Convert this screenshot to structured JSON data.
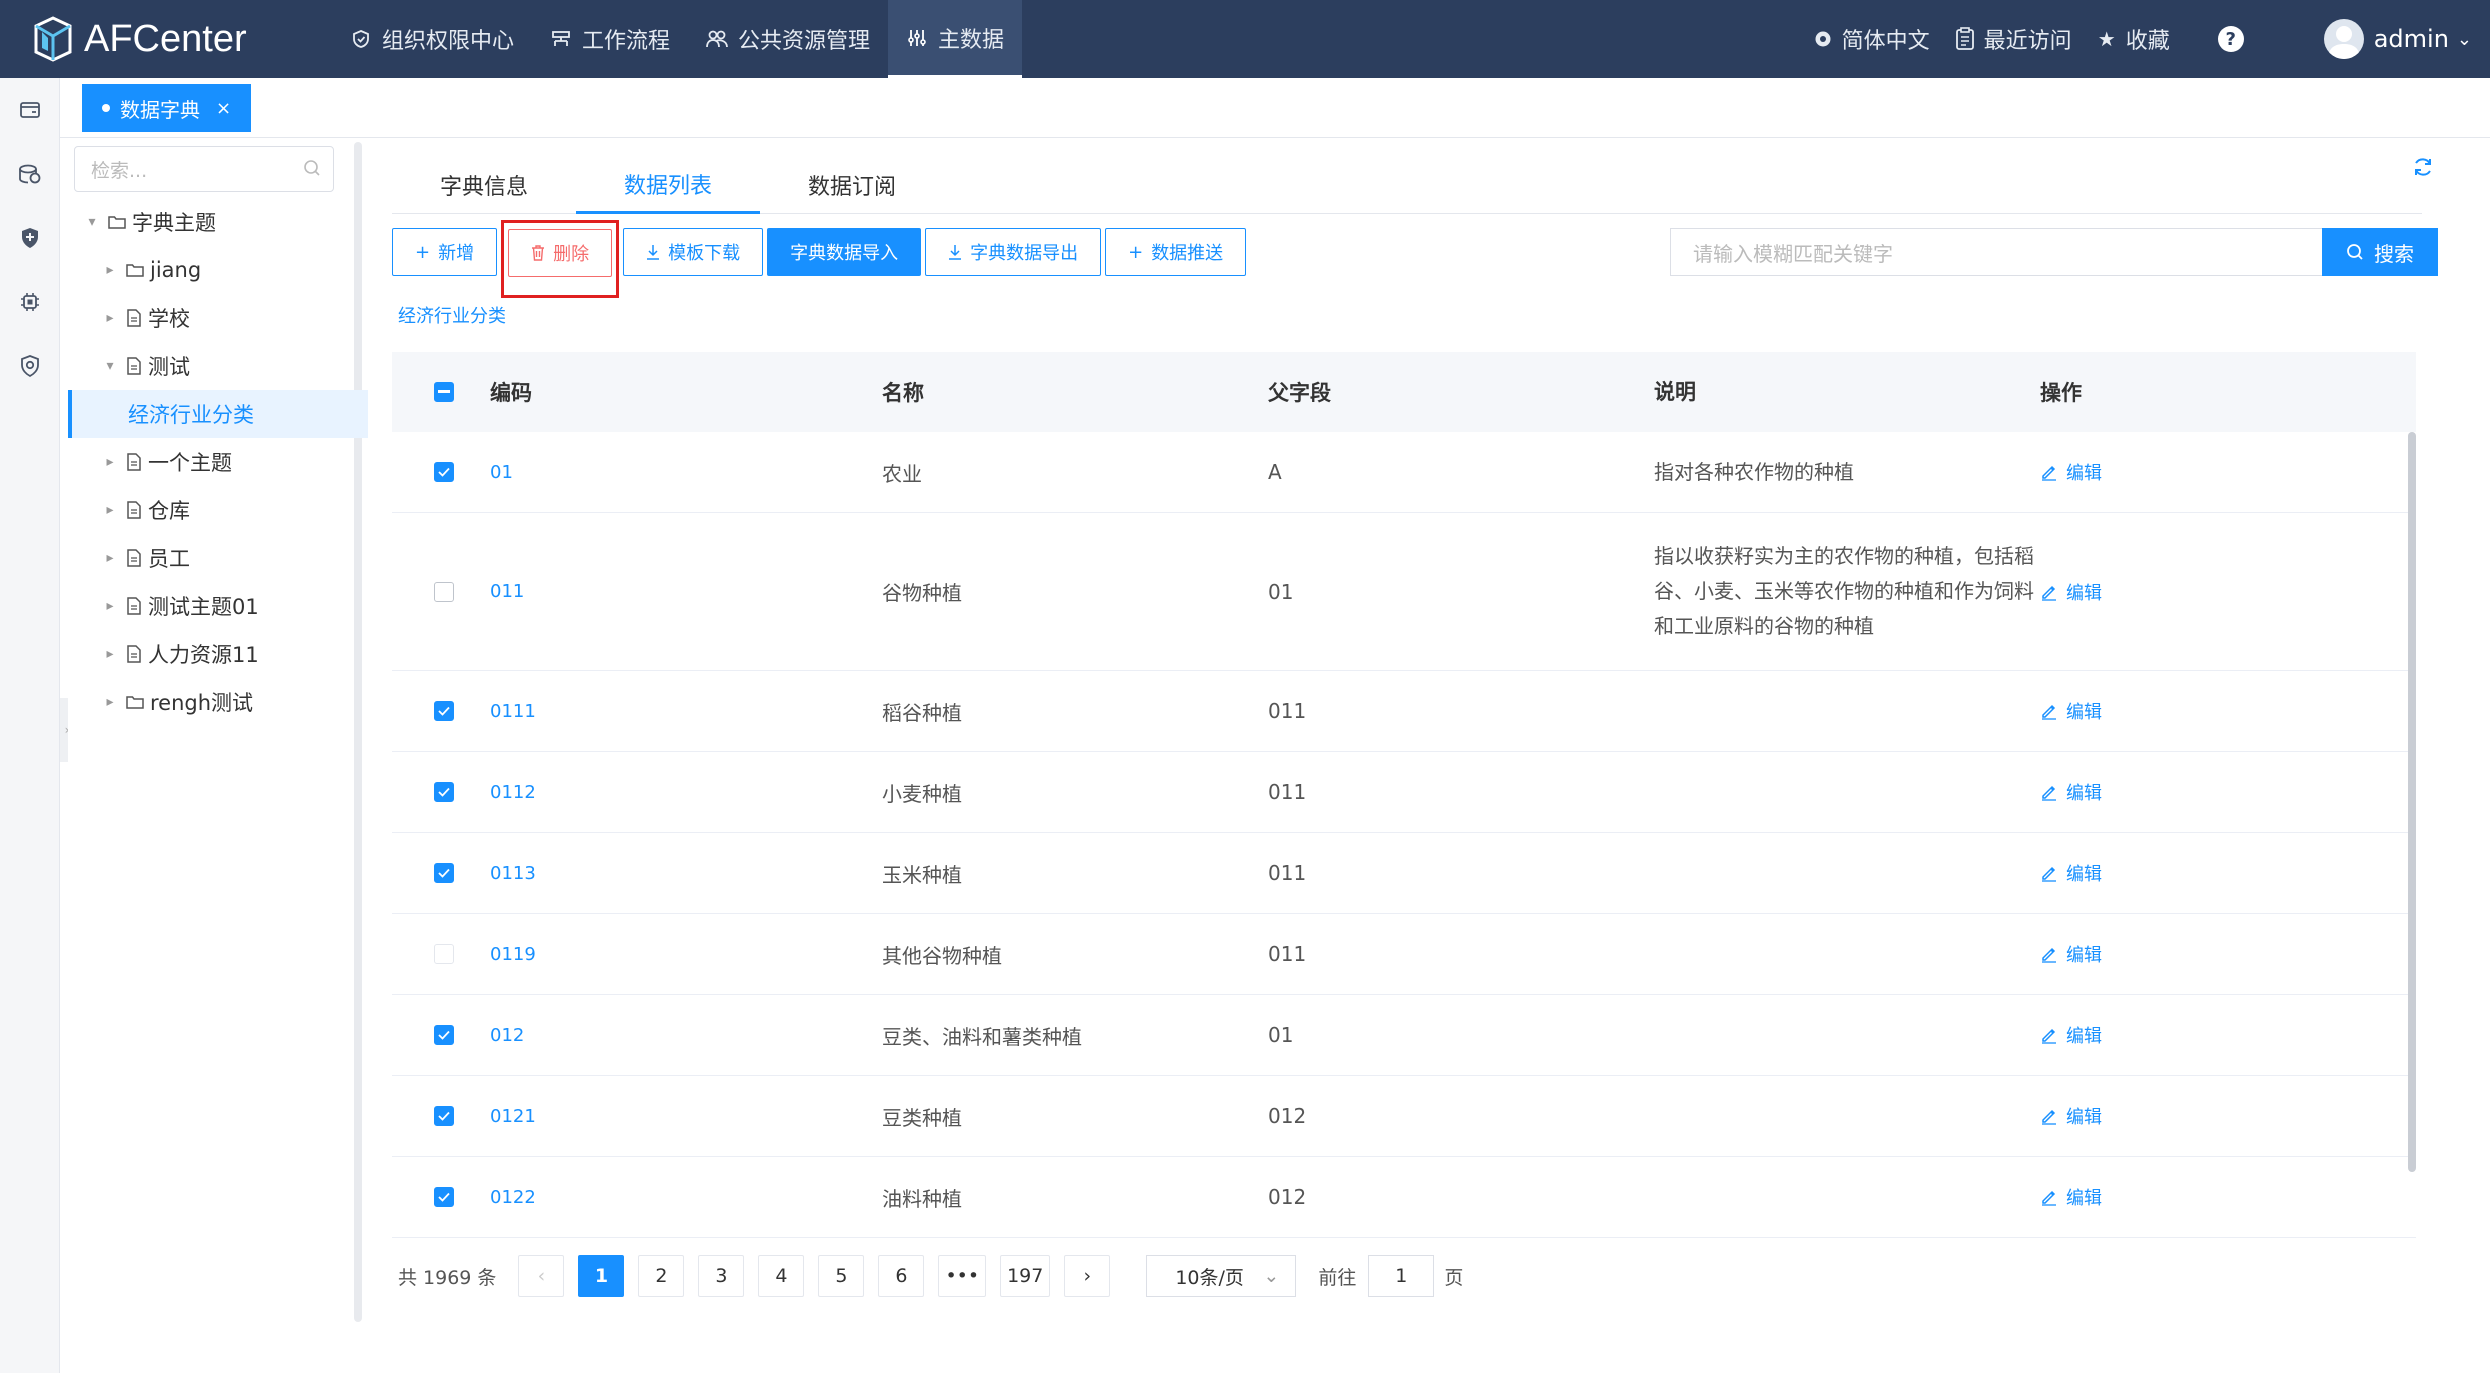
{
  "brand": {
    "name": "AFCenter"
  },
  "nav": [
    {
      "label": "组织权限中心",
      "icon": "shield-icon"
    },
    {
      "label": "工作流程",
      "icon": "flow-icon"
    },
    {
      "label": "公共资源管理",
      "icon": "people-icon"
    },
    {
      "label": "主数据",
      "icon": "data-icon",
      "active": true
    }
  ],
  "header_right": {
    "language": "简体中文",
    "recent": "最近访问",
    "favorites": "收藏",
    "help": "?",
    "user": "admin"
  },
  "page_tab": {
    "label": "数据字典",
    "close": "×"
  },
  "tree": {
    "search_placeholder": "检索...",
    "nodes": [
      {
        "label": "字典主题",
        "level": 0,
        "type": "folder",
        "expanded": true
      },
      {
        "label": "jiang",
        "level": 1,
        "type": "folder"
      },
      {
        "label": "学校",
        "level": 1,
        "type": "doc"
      },
      {
        "label": "测试",
        "level": 1,
        "type": "doc",
        "expanded": true
      },
      {
        "label": "经济行业分类",
        "level": 2,
        "type": "leaf",
        "selected": true
      },
      {
        "label": "一个主题",
        "level": 1,
        "type": "doc"
      },
      {
        "label": "仓库",
        "level": 1,
        "type": "doc"
      },
      {
        "label": "员工",
        "level": 1,
        "type": "doc"
      },
      {
        "label": "测试主题01",
        "level": 1,
        "type": "doc"
      },
      {
        "label": "人力资源11",
        "level": 1,
        "type": "doc"
      },
      {
        "label": "rengh测试",
        "level": 1,
        "type": "folder"
      }
    ]
  },
  "subtabs": [
    {
      "label": "字典信息"
    },
    {
      "label": "数据列表",
      "active": true
    },
    {
      "label": "数据订阅"
    }
  ],
  "toolbar": {
    "add": "新增",
    "delete": "删除",
    "template": "模板下载",
    "import": "字典数据导入",
    "export": "字典数据导出",
    "push": "数据推送"
  },
  "search": {
    "placeholder": "请输入模糊匹配关键字",
    "button": "搜索"
  },
  "breadcrumb": "经济行业分类",
  "table": {
    "headers": {
      "code": "编码",
      "name": "名称",
      "parent": "父字段",
      "desc": "说明",
      "op": "操作"
    },
    "edit_label": "编辑",
    "rows": [
      {
        "checked": true,
        "code": "01",
        "name": "农业",
        "parent": "A",
        "desc": "指对各种农作物的种植"
      },
      {
        "checked": false,
        "code": "011",
        "name": "谷物种植",
        "parent": "01",
        "desc": "指以收获籽实为主的农作物的种植，包括稻谷、小麦、玉米等农作物的种植和作为饲料和工业原料的谷物的种植"
      },
      {
        "checked": true,
        "code": "0111",
        "name": "稻谷种植",
        "parent": "011",
        "desc": ""
      },
      {
        "checked": true,
        "code": "0112",
        "name": "小麦种植",
        "parent": "011",
        "desc": ""
      },
      {
        "checked": true,
        "code": "0113",
        "name": "玉米种植",
        "parent": "011",
        "desc": ""
      },
      {
        "checked": false,
        "light": true,
        "code": "0119",
        "name": "其他谷物种植",
        "parent": "011",
        "desc": ""
      },
      {
        "checked": true,
        "code": "012",
        "name": "豆类、油料和薯类种植",
        "parent": "01",
        "desc": ""
      },
      {
        "checked": true,
        "code": "0121",
        "name": "豆类种植",
        "parent": "012",
        "desc": ""
      },
      {
        "checked": true,
        "code": "0122",
        "name": "油料种植",
        "parent": "012",
        "desc": ""
      }
    ]
  },
  "pagination": {
    "total": "共 1969 条",
    "prev": "‹",
    "next": "›",
    "pages": [
      "1",
      "2",
      "3",
      "4",
      "5",
      "6",
      "•••",
      "197"
    ],
    "current": "1",
    "page_size": "10条/页",
    "goto_label": "前往",
    "goto_value": "1",
    "page_suffix": "页"
  }
}
